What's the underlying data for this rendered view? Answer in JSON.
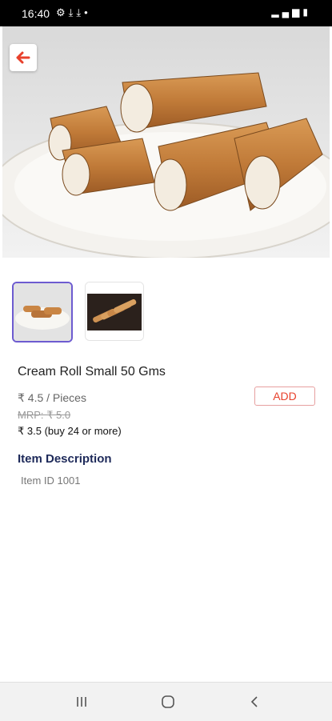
{
  "status_bar": {
    "time": "16:40",
    "left_icons": [
      "settings-icon",
      "download-done-icon",
      "download-done-icon",
      "dot-icon"
    ],
    "right_icons": [
      "signal-icon",
      "battery-icon"
    ]
  },
  "product": {
    "title": "Cream Roll Small 50 Gms",
    "price": "₹ 4.5 / Pieces",
    "mrp": "MRP: ₹ 5.0",
    "bulk_price": "₹ 3.5 (buy 24 or more)",
    "add_label": "ADD"
  },
  "description": {
    "heading": "Item Description",
    "text": "Item ID 1001"
  },
  "colors": {
    "accent": "#e8412c",
    "heading": "#1e2a5a",
    "thumb_selected": "#6d5bd0"
  },
  "nav": {
    "icons": [
      "recent-apps-icon",
      "home-icon",
      "back-icon"
    ]
  }
}
